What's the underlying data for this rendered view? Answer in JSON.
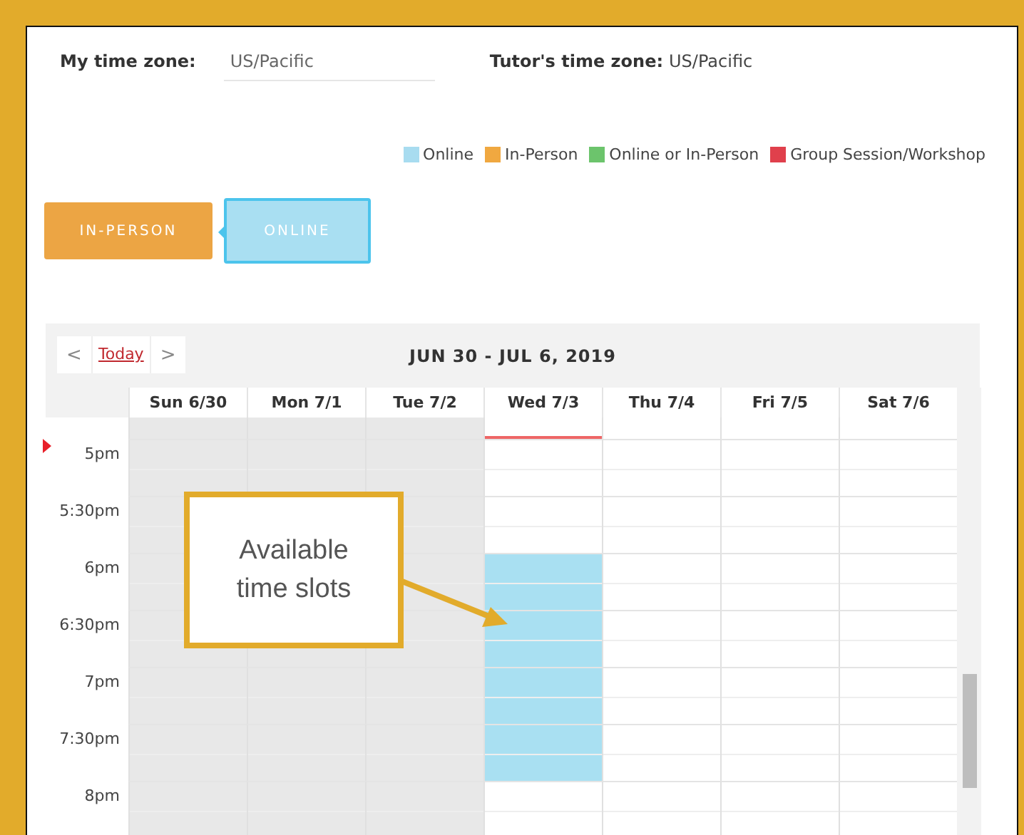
{
  "timezone": {
    "label": "My time zone:",
    "value": "US/Pacific",
    "tutor_label": "Tutor's time zone:",
    "tutor_value": "US/Pacific"
  },
  "legend": [
    {
      "label": "Online",
      "color": "#a8dcf0"
    },
    {
      "label": "In-Person",
      "color": "#f0a840"
    },
    {
      "label": "Online or In-Person",
      "color": "#6cc46c"
    },
    {
      "label": "Group Session/Workshop",
      "color": "#e0404c"
    }
  ],
  "modes": [
    {
      "label": "IN-PERSON",
      "kind": "in-person",
      "selected": false
    },
    {
      "label": "ONLINE",
      "kind": "online",
      "selected": true
    }
  ],
  "calendar": {
    "prev": "<",
    "today": "Today",
    "next": ">",
    "title": "JUN 30 - JUL 6, 2019",
    "days": [
      {
        "label": "Sun 6/30",
        "past": true,
        "today": false
      },
      {
        "label": "Mon 7/1",
        "past": true,
        "today": false
      },
      {
        "label": "Tue 7/2",
        "past": true,
        "today": false
      },
      {
        "label": "Wed 7/3",
        "past": false,
        "today": true,
        "available": [
          false,
          false,
          true,
          true,
          true,
          true,
          false
        ]
      },
      {
        "label": "Thu 7/4",
        "past": false,
        "today": false,
        "available": [
          false,
          false,
          false,
          false,
          false,
          false,
          false
        ]
      },
      {
        "label": "Fri 7/5",
        "past": false,
        "today": false,
        "available": [
          false,
          false,
          false,
          false,
          false,
          false,
          false
        ]
      },
      {
        "label": "Sat 7/6",
        "past": false,
        "today": false,
        "available": [
          false,
          false,
          false,
          false,
          false,
          false,
          false
        ]
      }
    ],
    "times": [
      "5pm",
      "5:30pm",
      "6pm",
      "6:30pm",
      "7pm",
      "7:30pm",
      "8pm"
    ]
  },
  "callout": {
    "text_lines": [
      "Available",
      "time slots"
    ]
  }
}
